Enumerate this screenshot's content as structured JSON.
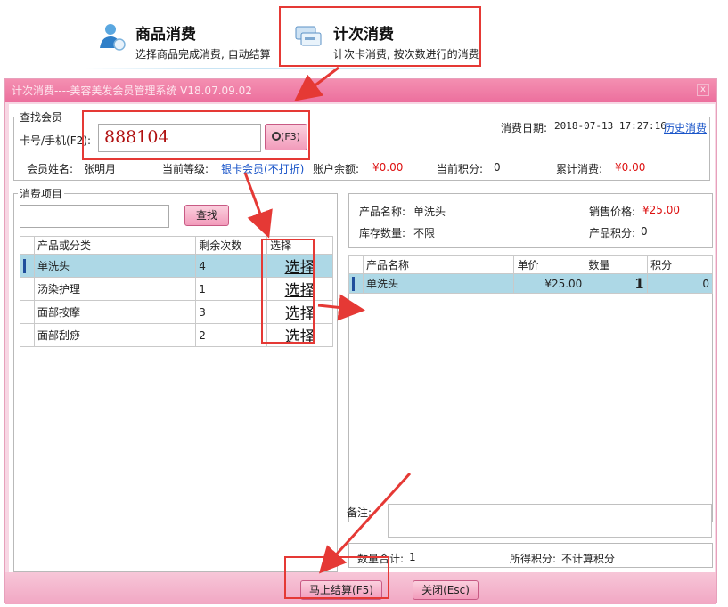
{
  "nav": {
    "goods": {
      "title": "商品消费",
      "subtitle": "选择商品完成消费, 自动结算"
    },
    "count": {
      "title": "计次消费",
      "subtitle": "计次卡消费, 按次数进行的消费"
    }
  },
  "window": {
    "title": "计次消费----美容美发会员管理系统 V18.07.09.02",
    "close_label": "x"
  },
  "member_search": {
    "legend": "查找会员",
    "card_label": "卡号/手机(F2):",
    "card_value": "888104",
    "search_button": "(F3)",
    "date_label": "消费日期:",
    "date_value": "2018-07-13 17:27:16",
    "history_link": "历史消费",
    "name_label": "会员姓名:",
    "name_value": "张明月",
    "level_label": "当前等级:",
    "level_value": "银卡会员(不打折)",
    "balance_label": "账户余额:",
    "balance_value": "¥0.00",
    "points_label": "当前积分:",
    "points_value": "0",
    "total_label": "累计消费:",
    "total_value": "¥0.00"
  },
  "items": {
    "legend": "消费项目",
    "search_button": "查找",
    "columns": [
      "产品或分类",
      "剩余次数",
      "选择"
    ],
    "rows": [
      {
        "name": "单洗头",
        "remaining": "4",
        "action": "选择"
      },
      {
        "name": "汤染护理",
        "remaining": "1",
        "action": "选择"
      },
      {
        "name": "面部按摩",
        "remaining": "3",
        "action": "选择"
      },
      {
        "name": "面部刮痧",
        "remaining": "2",
        "action": "选择"
      }
    ]
  },
  "product": {
    "name_label": "产品名称:",
    "name_value": "单洗头",
    "price_label": "销售价格:",
    "price_value": "¥25.00",
    "stock_label": "库存数量:",
    "stock_value": "不限",
    "points_label": "产品积分:",
    "points_value": "0"
  },
  "cart": {
    "columns": [
      "产品名称",
      "单价",
      "数量",
      "积分"
    ],
    "rows": [
      {
        "name": "单洗头",
        "price": "¥25.00",
        "qty": "1",
        "points": "0"
      }
    ]
  },
  "remark_label": "备注:",
  "summary": {
    "count_label": "数量合计:",
    "count_value": "1",
    "points_label": "所得积分:",
    "points_value": "不计算积分"
  },
  "buttons": {
    "checkout": "马上结算(F5)",
    "close": "关闭(Esc)"
  },
  "colors": {
    "title_bar": "#ec6f9d",
    "window_bg": "#f7d7e4",
    "selected_row": "#add8e6",
    "money_red": "#dd1111",
    "annotation_red": "#e53935"
  }
}
